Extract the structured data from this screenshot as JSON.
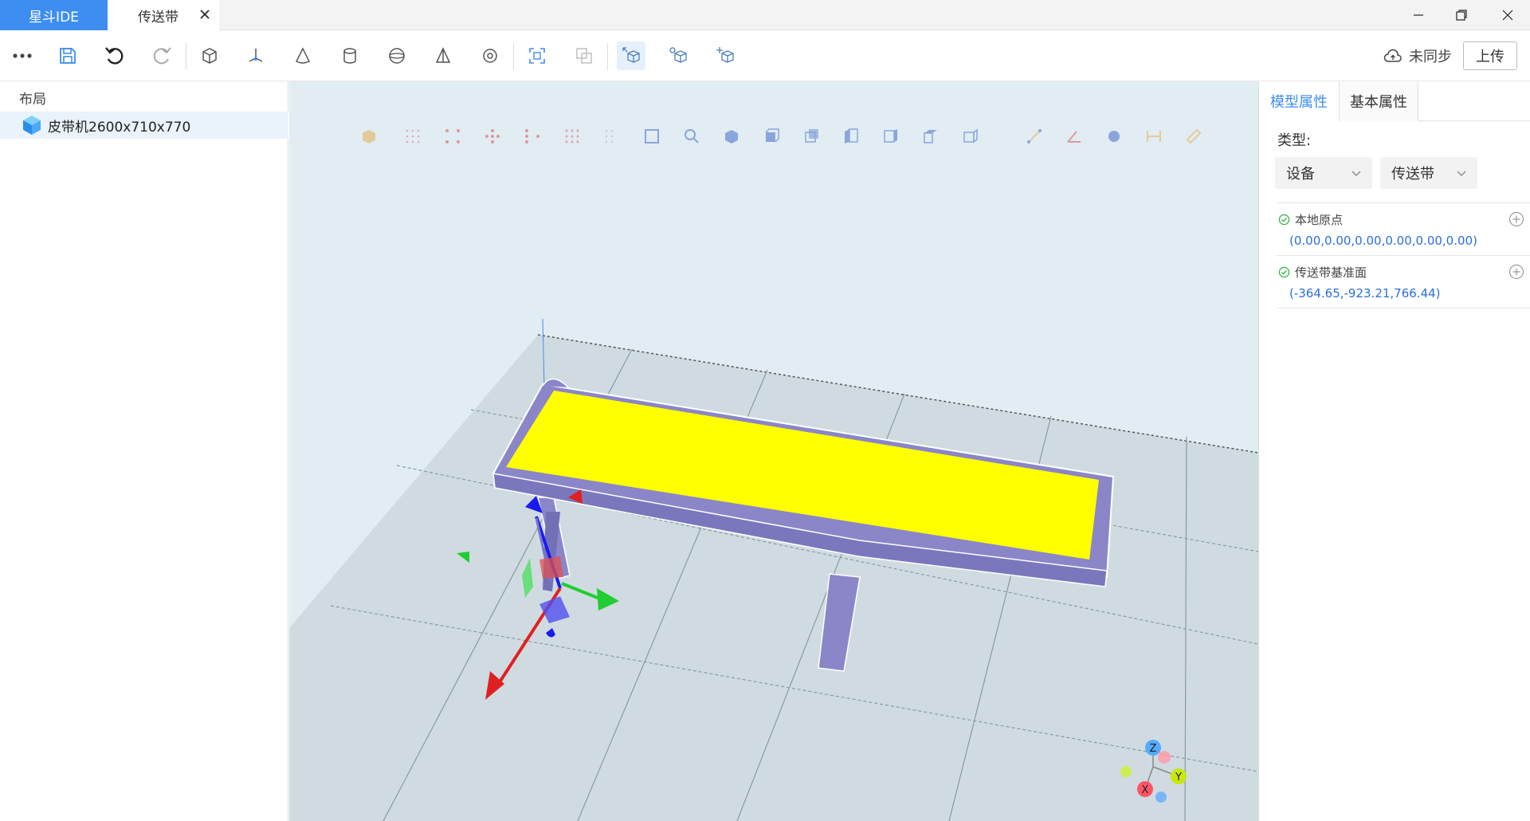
{
  "titlebar": {
    "app_tab": "星斗IDE",
    "doc_tab": "传送带"
  },
  "toolbar": {
    "more_icon": "more-dots-icon",
    "sync_label": "未同步",
    "upload_label": "上传"
  },
  "left_panel": {
    "title": "布局",
    "items": [
      {
        "label": "皮带机2600x710x770",
        "icon": "cube-icon"
      }
    ]
  },
  "right_panel": {
    "tabs": [
      "模型属性",
      "基本属性"
    ],
    "active_tab": "模型属性",
    "type_label": "类型:",
    "type_select_1": "设备",
    "type_select_2": "传送带",
    "properties": [
      {
        "name": "本地原点",
        "value": "(0.00,0.00,0.00,0.00,0.00,0.00)"
      },
      {
        "name": "传送带基准面",
        "value": "(-364.65,-923.21,766.44)"
      }
    ]
  },
  "gizmo": {
    "axes": [
      "Z",
      "Y",
      "X"
    ]
  },
  "colors": {
    "accent": "#3d8ef0",
    "belt_surface": "#ffff00",
    "frame": "#8a86c8",
    "viewport_bg": "#e1edf3",
    "floor": "#cfdbe0",
    "axis_x": "#e02020",
    "axis_y": "#22cc33",
    "axis_z": "#1a1aee"
  }
}
